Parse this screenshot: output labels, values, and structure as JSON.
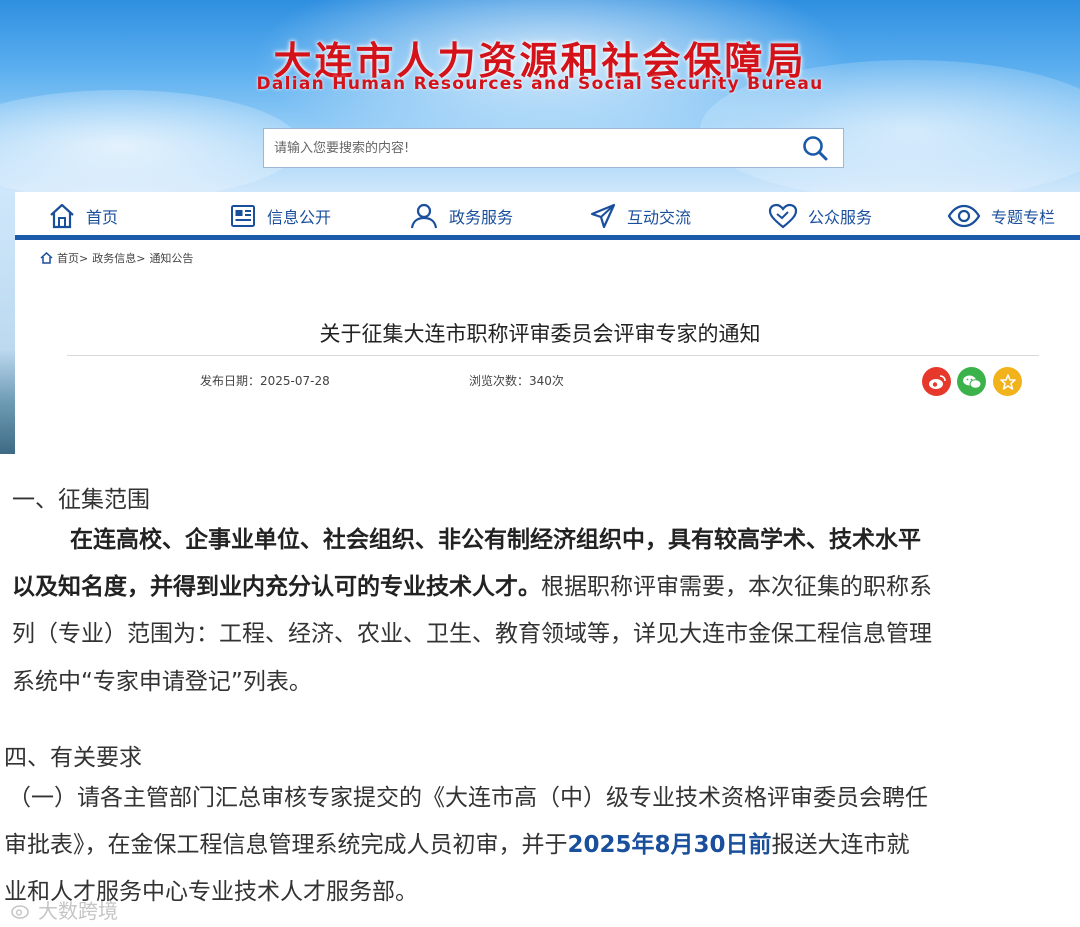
{
  "header": {
    "title": "大连市人力资源和社会保障局",
    "subtitle": "Dalian Human Resources and Social Security Bureau",
    "search_placeholder": "请输入您要搜索的内容!"
  },
  "nav": {
    "items": [
      {
        "label": "首页",
        "icon": "home-icon"
      },
      {
        "label": "信息公开",
        "icon": "newspaper-icon"
      },
      {
        "label": "政务服务",
        "icon": "user-icon"
      },
      {
        "label": "互动交流",
        "icon": "send-icon"
      },
      {
        "label": "公众服务",
        "icon": "heart-icon"
      },
      {
        "label": "专题专栏",
        "icon": "eye-icon"
      }
    ],
    "accent": "#1a5aa8"
  },
  "breadcrumb": {
    "home": "首页>",
    "level1": "政务信息>",
    "level2": "通知公告"
  },
  "article": {
    "title": "关于征集大连市职称评审委员会评审专家的通知",
    "publish_label": "发布日期：",
    "publish_date": "2025-07-28",
    "views_label": "浏览次数：",
    "views": "340次",
    "share": [
      {
        "icon": "weibo-icon",
        "color": "#e6392c"
      },
      {
        "icon": "wechat-icon",
        "color": "#3bb34a"
      },
      {
        "icon": "star-icon",
        "color": "#f2b21c"
      }
    ]
  },
  "content": {
    "section1_heading": "一、征集范围",
    "para1_bold_line1": "在连高校、企事业单位、社会组织、非公有制经济组织中，具有较高学术、技术水平",
    "para1_bold_line2": "以及知名度，并得到业内充分认可的专业技术人才。",
    "para1_rest_line2": "根据职称评审需要，本次征集的职称系",
    "para1_line3": "列（专业）范围为：工程、经济、农业、卫生、教育领域等，详见大连市金保工程信息管理",
    "para1_line4": "系统中“专家申请登记”列表。",
    "section4_heading": "四、有关要求",
    "para2_line1": "（一）请各主管部门汇总审核专家提交的《大连市高（中）级专业技术资格评审委员会聘任",
    "para2_line2_a": "审批表》，在金保工程信息管理系统完成人员初审，并于",
    "para2_line2_highlight": "2025年8月30日前",
    "para2_line2_b": "报送大连市就",
    "para2_line3": "业和人才服务中心专业技术人才服务部。"
  },
  "watermark": "大数跨境"
}
